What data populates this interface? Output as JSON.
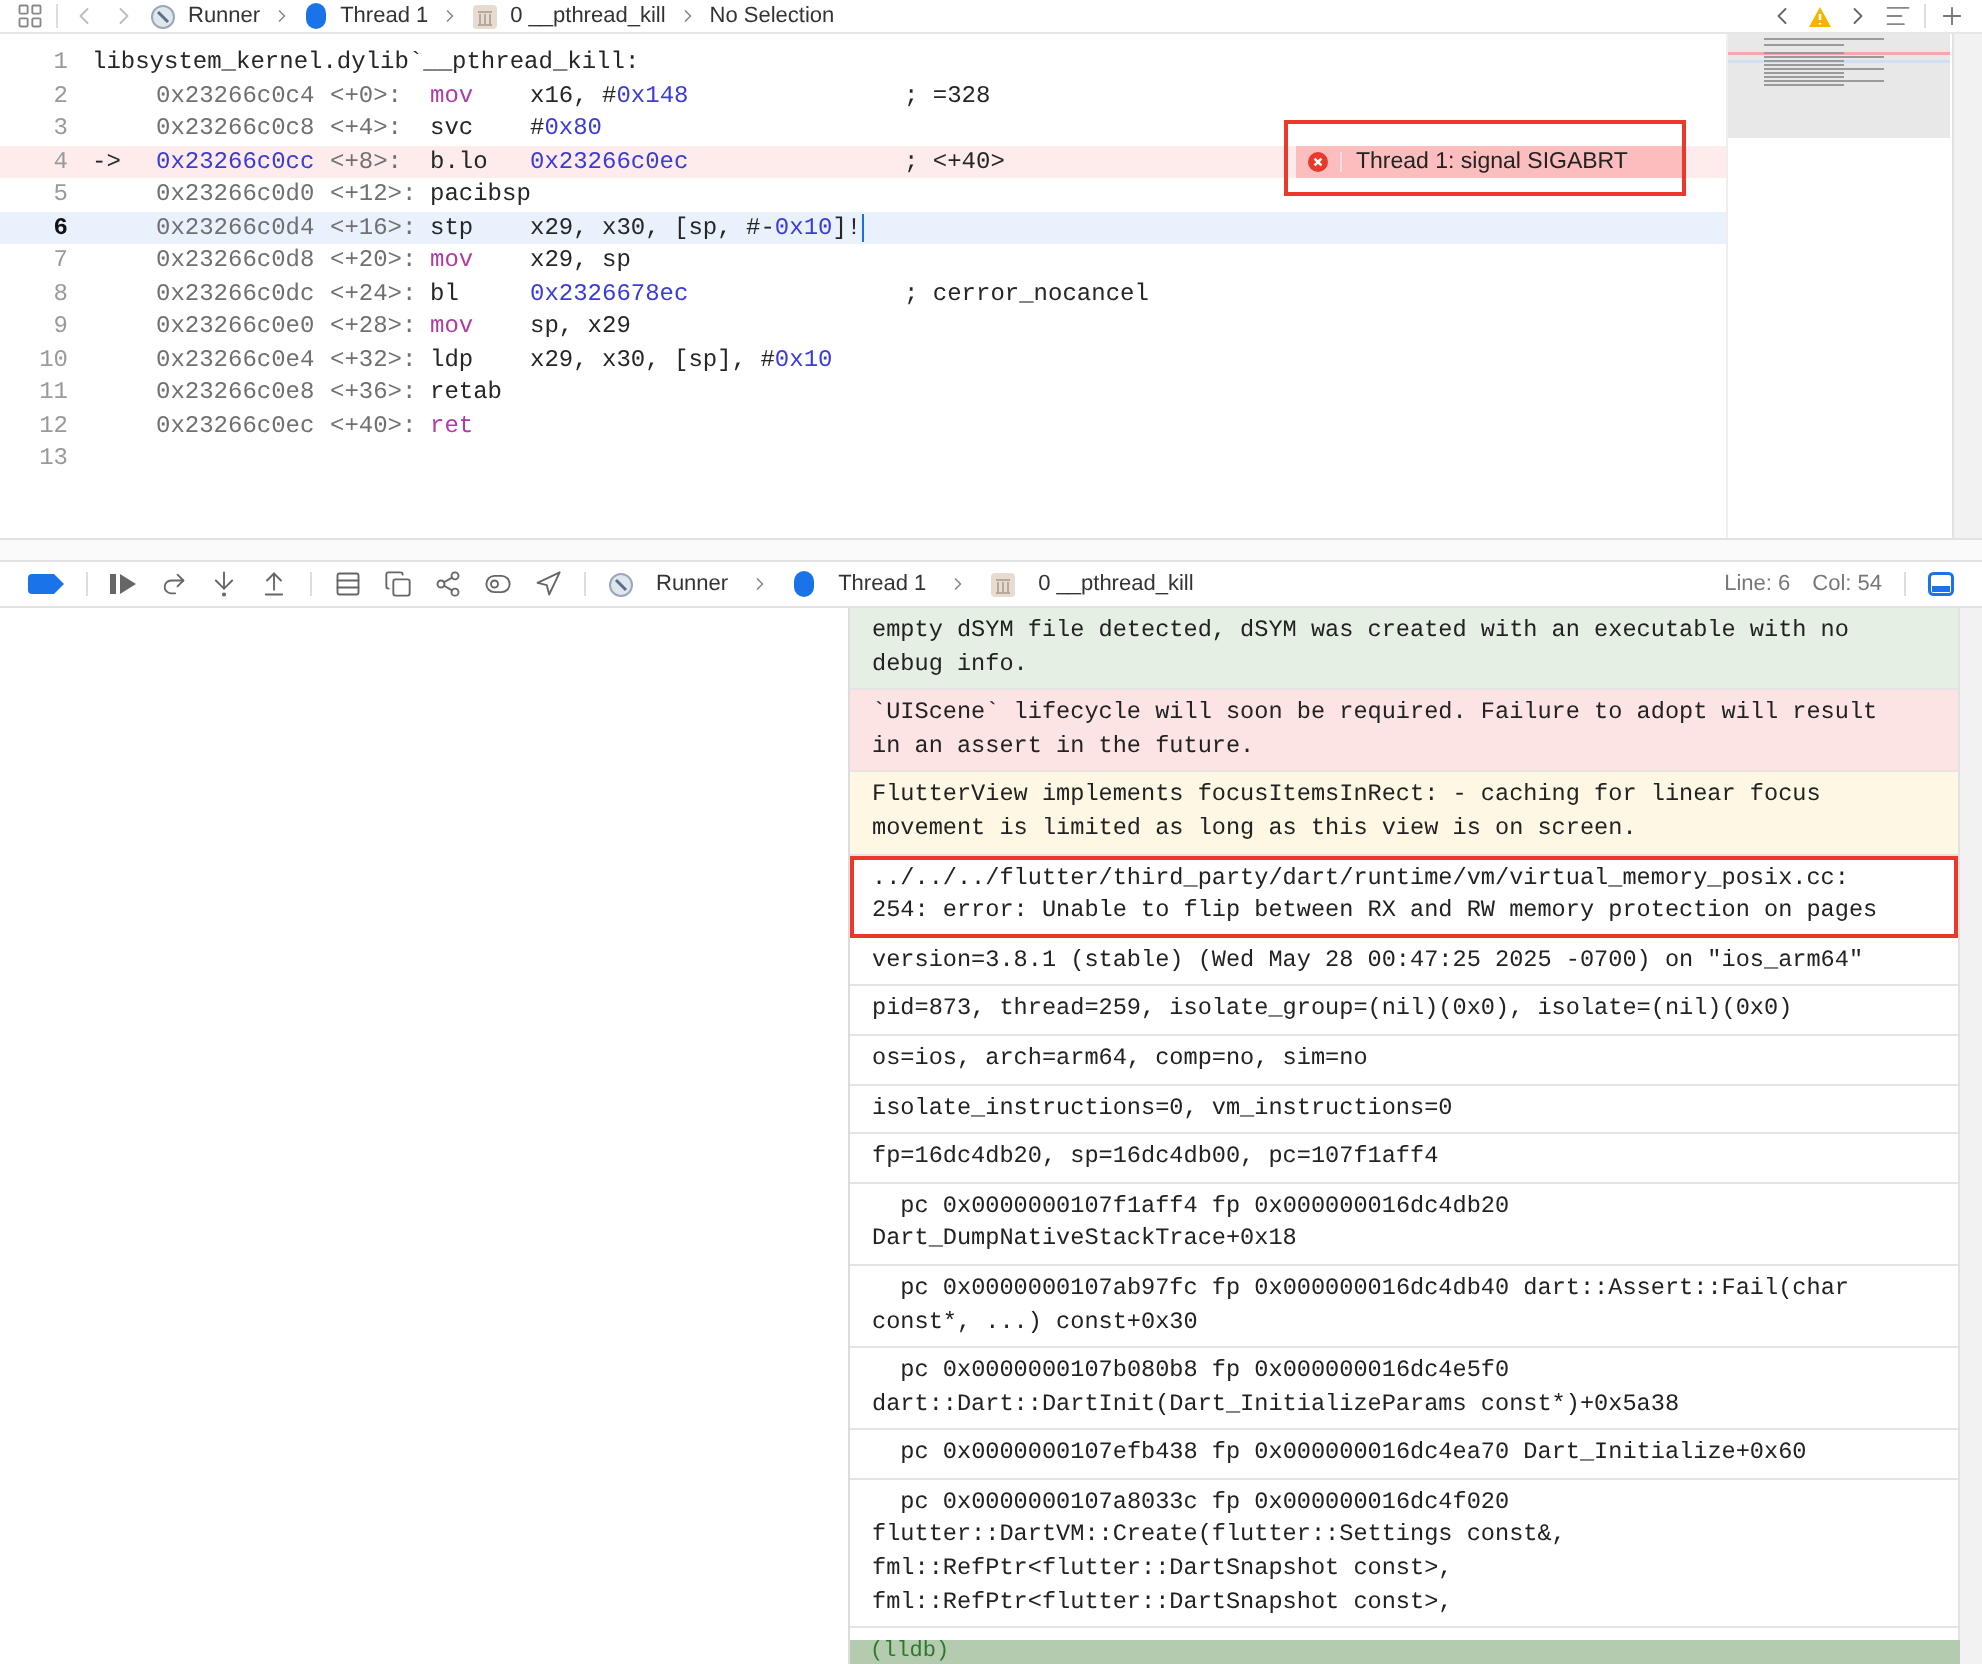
{
  "breadcrumbs": [
    {
      "label": "Runner",
      "kind": "app"
    },
    {
      "label": "Thread 1",
      "kind": "thread"
    },
    {
      "label": "0 __pthread_kill",
      "kind": "frame"
    },
    {
      "label": "No Selection",
      "kind": "plain"
    }
  ],
  "code_lines": [
    {
      "number": "1",
      "kind": "plain",
      "header": "libsystem_kernel.dylib`__pthread_kill:"
    },
    {
      "number": "2",
      "kind": "plain",
      "address": "0x23266c0c4",
      "offset": "<+0>:",
      "mnemonic": {
        "text": "mov",
        "kind": "keyword"
      },
      "operands": [
        {
          "text": "x16, #",
          "kind": "plain"
        },
        {
          "text": "0x148",
          "kind": "number"
        }
      ],
      "comment": "; =328"
    },
    {
      "number": "3",
      "kind": "plain",
      "address": "0x23266c0c8",
      "offset": "<+4>:",
      "mnemonic": {
        "text": "svc",
        "kind": "plain"
      },
      "operands": [
        {
          "text": "#",
          "kind": "plain"
        },
        {
          "text": "0x80",
          "kind": "number"
        }
      ]
    },
    {
      "number": "4",
      "kind": "pc",
      "arrow": "->",
      "address": "0x23266c0cc",
      "offset": "<+8>:",
      "mnemonic": {
        "text": "b.lo",
        "kind": "plain"
      },
      "operands": [
        {
          "text": "0x23266c0ec",
          "kind": "number"
        }
      ],
      "comment": "; <+40>",
      "issue": {
        "text": "Thread 1: signal SIGABRT",
        "highlighted": true
      }
    },
    {
      "number": "5",
      "kind": "plain",
      "address": "0x23266c0d0",
      "offset": "<+12>:",
      "mnemonic": {
        "text": "pacibsp",
        "kind": "plain"
      }
    },
    {
      "number": "6",
      "kind": "cursor",
      "address": "0x23266c0d4",
      "offset": "<+16>:",
      "mnemonic": {
        "text": "stp",
        "kind": "plain"
      },
      "operands": [
        {
          "text": "x29, x30, [sp, #-",
          "kind": "plain"
        },
        {
          "text": "0x10",
          "kind": "number"
        },
        {
          "text": "]!",
          "kind": "plain"
        }
      ]
    },
    {
      "number": "7",
      "kind": "plain",
      "address": "0x23266c0d8",
      "offset": "<+20>:",
      "mnemonic": {
        "text": "mov",
        "kind": "keyword"
      },
      "operands": [
        {
          "text": "x29, sp",
          "kind": "plain"
        }
      ]
    },
    {
      "number": "8",
      "kind": "plain",
      "address": "0x23266c0dc",
      "offset": "<+24>:",
      "mnemonic": {
        "text": "bl",
        "kind": "plain"
      },
      "operands": [
        {
          "text": "0x2326678ec",
          "kind": "number"
        }
      ],
      "comment": "; cerror_nocancel"
    },
    {
      "number": "9",
      "kind": "plain",
      "address": "0x23266c0e0",
      "offset": "<+28>:",
      "mnemonic": {
        "text": "mov",
        "kind": "keyword"
      },
      "operands": [
        {
          "text": "sp, x29",
          "kind": "plain"
        }
      ]
    },
    {
      "number": "10",
      "kind": "plain",
      "address": "0x23266c0e4",
      "offset": "<+32>:",
      "mnemonic": {
        "text": "ldp",
        "kind": "plain"
      },
      "operands": [
        {
          "text": "x29, x30, [sp], #",
          "kind": "plain"
        },
        {
          "text": "0x10",
          "kind": "number"
        }
      ]
    },
    {
      "number": "11",
      "kind": "plain",
      "address": "0x23266c0e8",
      "offset": "<+36>:",
      "mnemonic": {
        "text": "retab",
        "kind": "plain"
      }
    },
    {
      "number": "12",
      "kind": "plain",
      "address": "0x23266c0ec",
      "offset": "<+40>:",
      "mnemonic": {
        "text": "ret",
        "kind": "keyword"
      }
    },
    {
      "number": "13",
      "kind": "plain"
    }
  ],
  "debug_bar": {
    "breadcrumbs": [
      {
        "label": "Runner",
        "kind": "app"
      },
      {
        "label": "Thread 1",
        "kind": "thread"
      },
      {
        "label": "0 __pthread_kill",
        "kind": "frame"
      }
    ],
    "line": "Line: 6",
    "col": "Col: 54"
  },
  "console": {
    "messages": [
      {
        "kind": "note",
        "highlighted": false,
        "text": "empty dSYM file detected, dSYM was created with an executable with no debug info."
      },
      {
        "kind": "error",
        "highlighted": false,
        "text": "`UIScene` lifecycle will soon be required. Failure to adopt will result in an assert in the future."
      },
      {
        "kind": "warning",
        "highlighted": false,
        "text": "FlutterView implements focusItemsInRect: - caching for linear focus movement is limited as long as this view is on screen."
      },
      {
        "kind": "plain",
        "highlighted": true,
        "text": "../../../flutter/third_party/dart/runtime/vm/virtual_memory_posix.cc:\n254: error: Unable to flip between RX and RW memory protection on pages"
      },
      {
        "kind": "plain",
        "highlighted": false,
        "text": "version=3.8.1 (stable) (Wed May 28 00:47:25 2025 -0700) on \"ios_arm64\""
      },
      {
        "kind": "plain",
        "highlighted": false,
        "text": "pid=873, thread=259, isolate_group=(nil)(0x0), isolate=(nil)(0x0)"
      },
      {
        "kind": "plain",
        "highlighted": false,
        "text": "os=ios, arch=arm64, comp=no, sim=no"
      },
      {
        "kind": "plain",
        "highlighted": false,
        "text": "isolate_instructions=0, vm_instructions=0"
      },
      {
        "kind": "plain",
        "highlighted": false,
        "text": "fp=16dc4db20, sp=16dc4db00, pc=107f1aff4"
      },
      {
        "kind": "plain",
        "highlighted": false,
        "text": "  pc 0x0000000107f1aff4 fp 0x000000016dc4db20\nDart_DumpNativeStackTrace+0x18"
      },
      {
        "kind": "plain",
        "highlighted": false,
        "text": "  pc 0x0000000107ab97fc fp 0x000000016dc4db40 dart::Assert::Fail(char\nconst*, ...) const+0x30"
      },
      {
        "kind": "plain",
        "highlighted": false,
        "text": "  pc 0x0000000107b080b8 fp 0x000000016dc4e5f0\ndart::Dart::DartInit(Dart_InitializeParams const*)+0x5a38"
      },
      {
        "kind": "plain",
        "highlighted": false,
        "text": "  pc 0x0000000107efb438 fp 0x000000016dc4ea70 Dart_Initialize+0x60"
      },
      {
        "kind": "plain",
        "highlighted": false,
        "text": "  pc 0x0000000107a8033c fp 0x000000016dc4f020\nflutter::DartVM::Create(flutter::Settings const&,\nfml::RefPtr<flutter::DartSnapshot const>,\nfml::RefPtr<flutter::DartSnapshot const>,"
      }
    ],
    "prompt": "(lldb)"
  }
}
